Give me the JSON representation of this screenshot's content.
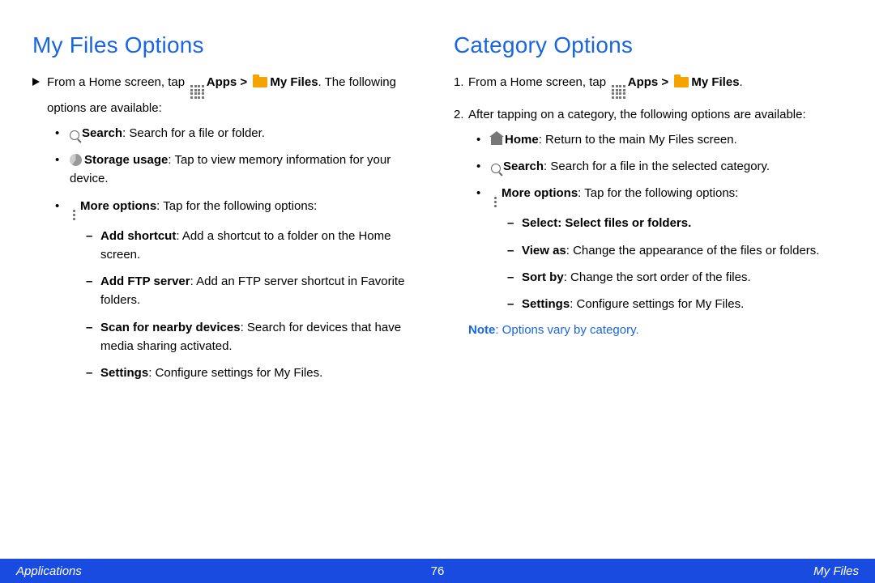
{
  "left": {
    "title": "My Files Options",
    "intro_prefix": "From a Home screen, tap ",
    "apps_label": "Apps",
    "gt": " > ",
    "myfiles_label": "My Files",
    "intro_suffix": ". The following options are available:",
    "search_b": "Search",
    "search_t": ": Search for a file or folder.",
    "storage_b": "Storage usage",
    "storage_t": ": Tap to view memory information for your device.",
    "more_b": "More options",
    "more_t": ": Tap for the following options:",
    "d1_b": "Add shortcut",
    "d1_t": ": Add a shortcut to a folder on the Home screen.",
    "d2_b": "Add FTP server",
    "d2_t": ": Add an FTP server shortcut in Favorite folders.",
    "d3_b": "Scan for nearby devices",
    "d3_t": ": Search for devices that have media sharing activated.",
    "d4_b": "Settings",
    "d4_t": ": Configure settings for My Files."
  },
  "right": {
    "title": "Category Options",
    "s1_prefix": "From a Home screen, tap ",
    "apps_label": "Apps",
    "gt": " > ",
    "myfiles_label": "My Files",
    "s1_suffix": ".",
    "s2": "After tapping on a category, the following options are available:",
    "home_b": "Home",
    "home_t": ": Return to the main My Files screen.",
    "search_b": "Search",
    "search_t": ": Search for a file in the selected category.",
    "more_b": "More options",
    "more_t": ": Tap for the following options:",
    "d1_b": "Select",
    "d1_t": ": Select files or folders.",
    "d2_b": "View as",
    "d2_t": ": Change the appearance of the files or folders.",
    "d3_b": "Sort by",
    "d3_t": ": Change the sort order of the files.",
    "d4_b": "Settings",
    "d4_t": ": Configure settings for My Files.",
    "note_b": "Note",
    "note_t": ": Options vary by category."
  },
  "footer": {
    "left": "Applications",
    "center": "76",
    "right": "My Files"
  }
}
